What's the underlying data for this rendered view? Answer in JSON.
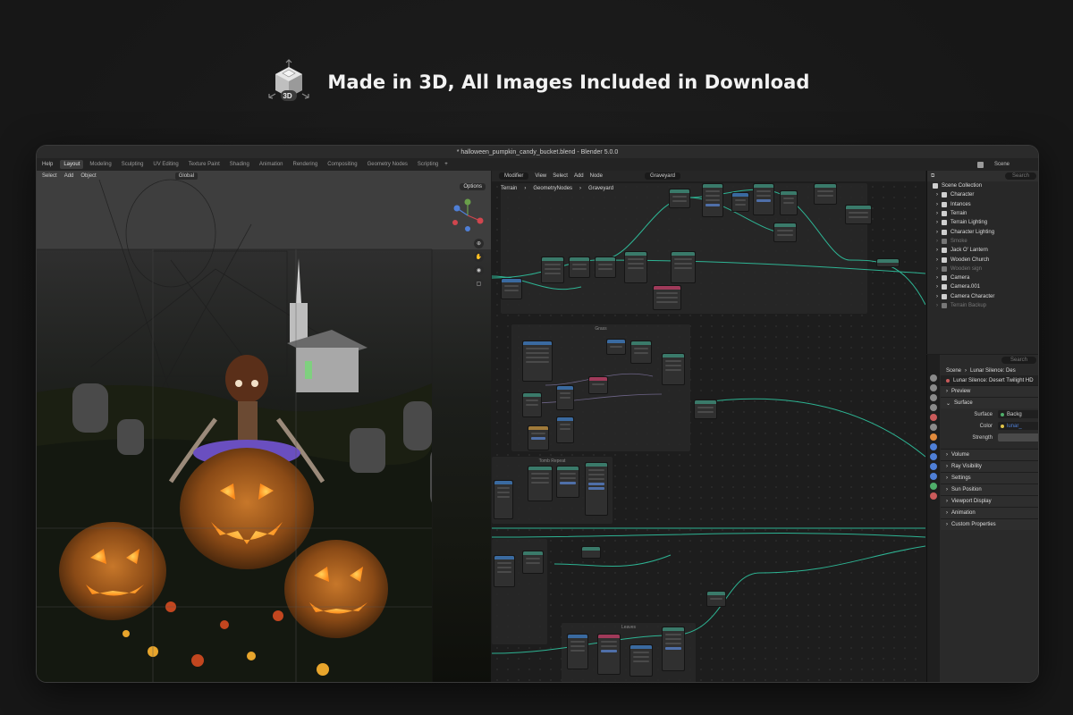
{
  "banner": {
    "title": "Made in 3D, All Images Included in Download",
    "logo_label": "3D",
    "logo_icon": "cube-3d-icon"
  },
  "window": {
    "title": "* halloween_pumpkin_candy_bucket.blend - Blender 5.0.0"
  },
  "topbar": {
    "menu": [
      "Help"
    ],
    "tabs": [
      "Layout",
      "Modeling",
      "Sculpting",
      "UV Editing",
      "Texture Paint",
      "Shading",
      "Animation",
      "Rendering",
      "Compositing",
      "Geometry Nodes",
      "Scripting"
    ],
    "active_tab": "Layout",
    "add_tab": "+",
    "scene_label": "Scene",
    "search_placeholder": "Search"
  },
  "viewport": {
    "menu": [
      "Select",
      "Add",
      "Object"
    ],
    "orientation": "Global",
    "options": "Options"
  },
  "node_editor": {
    "editor": "Modifier",
    "menu": [
      "View",
      "Select",
      "Add",
      "Node"
    ],
    "node_tree": "Graveyard",
    "breadcrumbs": [
      "Terrain",
      "GeometryNodes",
      "Graveyard"
    ],
    "frames": [
      "Grass",
      "Tomb Repeat",
      "Leaves"
    ]
  },
  "outliner": {
    "header": "Scene Collection",
    "search_placeholder": "Search",
    "items": [
      {
        "label": "Character",
        "dim": false,
        "color": "#cfcfcf"
      },
      {
        "label": "Intances",
        "dim": false,
        "color": "#cfcfcf"
      },
      {
        "label": "Terrain",
        "dim": false,
        "color": "#cfcfcf"
      },
      {
        "label": "Terrain Lighting",
        "dim": false,
        "color": "#cfcfcf"
      },
      {
        "label": "Character Lighting",
        "dim": false,
        "color": "#cfcfcf"
      },
      {
        "label": "Smoke",
        "dim": true,
        "color": "#777"
      },
      {
        "label": "Jack O' Lantern",
        "dim": false,
        "color": "#cfcfcf"
      },
      {
        "label": "Wooden Church",
        "dim": false,
        "color": "#cfcfcf"
      },
      {
        "label": "Wooden sign",
        "dim": true,
        "color": "#777"
      },
      {
        "label": "Camera",
        "dim": false,
        "color": "#cfcfcf"
      },
      {
        "label": "Camera.001",
        "dim": false,
        "color": "#cfcfcf"
      },
      {
        "label": "Camera Character",
        "dim": false,
        "color": "#cfcfcf"
      },
      {
        "label": "Terrain Backup",
        "dim": true,
        "color": "#777"
      }
    ]
  },
  "properties": {
    "search_placeholder": "Search",
    "breadcrumb": [
      "Scene",
      "Lunar Silence: Des"
    ],
    "world_name": "Lunar Silence: Desert Twilight HD",
    "sections": [
      "Preview",
      "Surface"
    ],
    "surface": {
      "label": "Surface",
      "value": "Backg"
    },
    "color": {
      "label": "Color",
      "value": "lunar_"
    },
    "strength": {
      "label": "Strength",
      "value": ""
    },
    "more_sections": [
      "Volume",
      "Ray Visibility",
      "Settings",
      "Sun Position",
      "Viewport Display",
      "Animation",
      "Custom Properties"
    ]
  },
  "colors": {
    "accent": "#4772b3",
    "wire": "#2fc4a0",
    "orange": "#e08a3c"
  }
}
